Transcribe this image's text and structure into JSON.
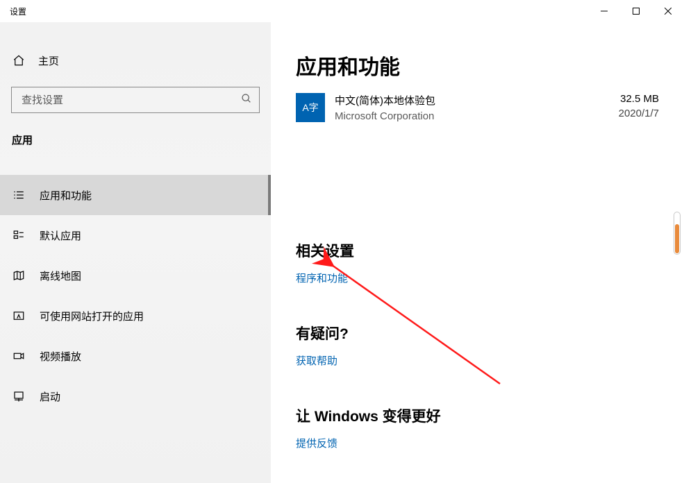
{
  "window": {
    "title": "设置"
  },
  "sidebar": {
    "home_label": "主页",
    "search_placeholder": "查找设置",
    "category": "应用",
    "items": [
      {
        "label": "应用和功能"
      },
      {
        "label": "默认应用"
      },
      {
        "label": "离线地图"
      },
      {
        "label": "可使用网站打开的应用"
      },
      {
        "label": "视频播放"
      },
      {
        "label": "启动"
      }
    ]
  },
  "main": {
    "page_title": "应用和功能",
    "app": {
      "name": "中文(简体)本地体验包",
      "publisher": "Microsoft Corporation",
      "size": "32.5 MB",
      "date": "2020/1/7",
      "icon_text": "A字"
    },
    "sections": {
      "related": {
        "heading": "相关设置",
        "link": "程序和功能"
      },
      "question": {
        "heading": "有疑问?",
        "link": "获取帮助"
      },
      "improve": {
        "heading": "让 Windows 变得更好",
        "link": "提供反馈"
      }
    }
  }
}
